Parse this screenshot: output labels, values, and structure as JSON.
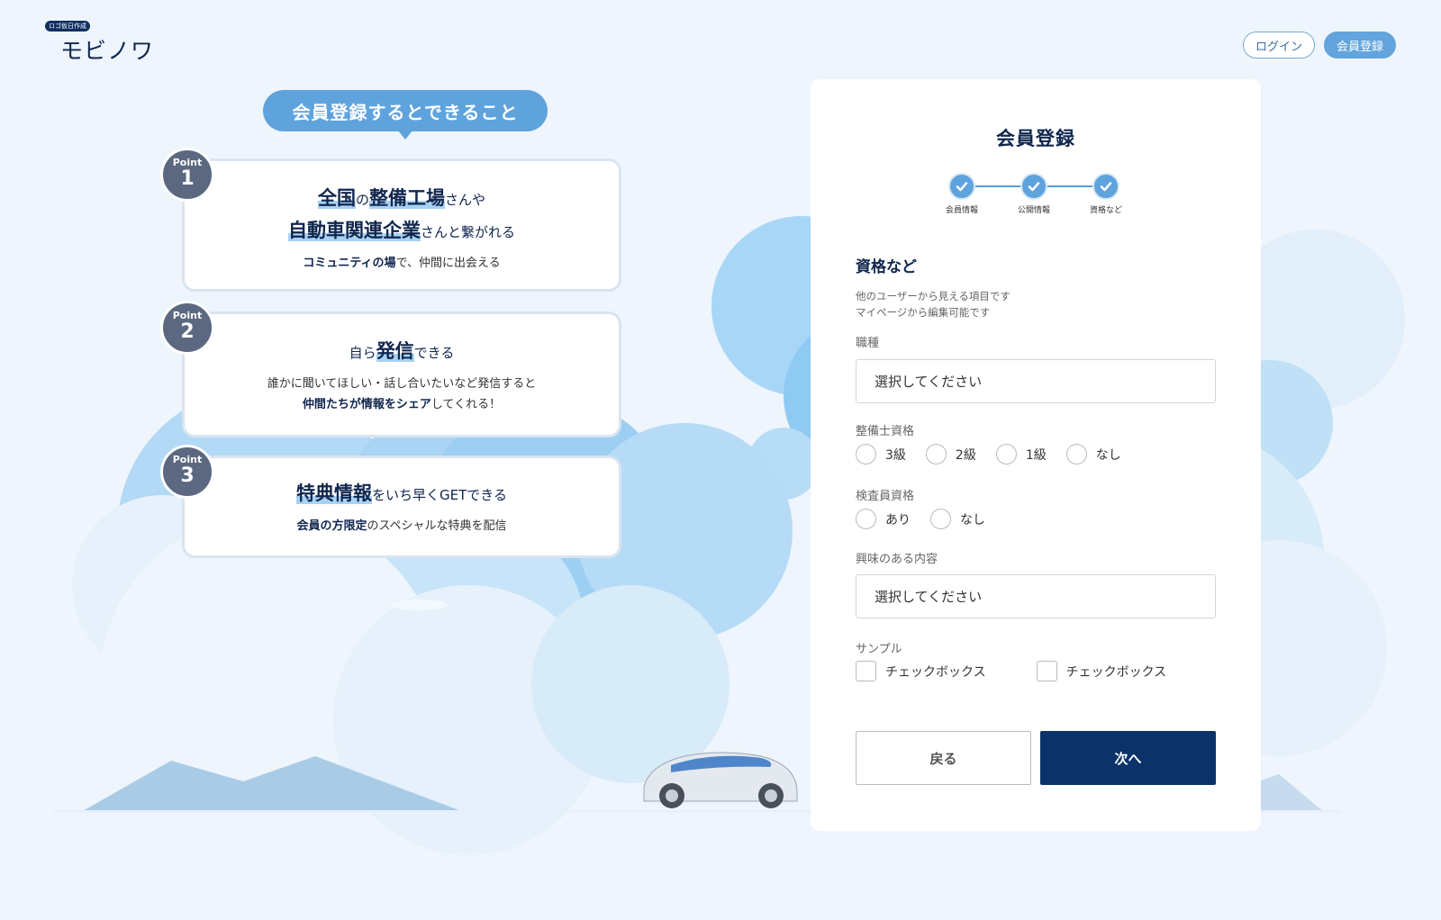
{
  "header": {
    "logo_badge": "ロゴ仮日作成",
    "logo_text": "モビノワ",
    "login_label": "ログイン",
    "register_label": "会員登録"
  },
  "benefits": {
    "bubble_title": "会員登録するとできること",
    "points": [
      {
        "label": "Point",
        "number": "1",
        "line1": {
          "a": "全国",
          "b": "の",
          "c": "整備工場",
          "d": "さんや"
        },
        "line2": {
          "a": "自動車関連企業",
          "b": "さんと繋がれる"
        },
        "sub": {
          "a": "コミュニティの場",
          "b": "で、仲間に出会える"
        }
      },
      {
        "label": "Point",
        "number": "2",
        "line1": {
          "a": "自ら",
          "b": "発信",
          "c": "できる"
        },
        "sub1": "誰かに聞いてほしい・話し合いたいなど発信すると",
        "sub2": {
          "a": "仲間たちが情報をシェア",
          "b": "してくれる！"
        }
      },
      {
        "label": "Point",
        "number": "3",
        "line1": {
          "a": "特典情報",
          "b": "をいち早くGETできる"
        },
        "sub": {
          "a": "会員の方限定",
          "b": "のスペシャルな特典を配信"
        }
      }
    ]
  },
  "form": {
    "title": "会員登録",
    "steps": [
      "会員情報",
      "公開情報",
      "資格など"
    ],
    "section_title": "資格など",
    "section_desc": [
      "他のユーザーから見える項目です",
      "マイページから編集可能です"
    ],
    "job_label": "職種",
    "job_placeholder": "選択してください",
    "mechanic_label": "整備士資格",
    "mechanic_options": [
      "3級",
      "2級",
      "1級",
      "なし"
    ],
    "inspector_label": "検査員資格",
    "inspector_options": [
      "あり",
      "なし"
    ],
    "interest_label": "興味のある内容",
    "interest_placeholder": "選択してください",
    "sample_label": "サンプル",
    "checkbox_options": [
      "チェックボックス",
      "チェックボックス"
    ],
    "back_label": "戻る",
    "next_label": "次へ"
  },
  "colors": {
    "navy": "#0b3369",
    "accent": "#5fa3dd",
    "background": "#eef5fc"
  }
}
